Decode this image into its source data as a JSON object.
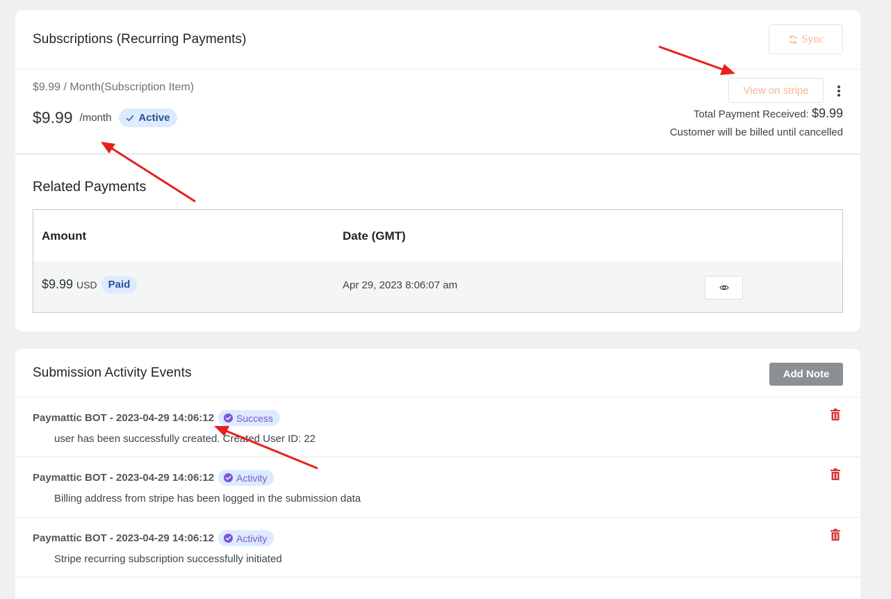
{
  "subscription_card": {
    "title": "Subscriptions (Recurring Payments)",
    "sync_label": "Sync",
    "plan_name": "$9.99 / Month(Subscription Item)",
    "price": "$9.99",
    "interval": "/month",
    "status": "Active",
    "view_on_stripe_label": "View on stripe",
    "total_label": "Total Payment Received:",
    "total_value": "$9.99",
    "billing_note": "Customer will be billed until cancelled"
  },
  "related_payments": {
    "title": "Related Payments",
    "columns": [
      "Amount",
      "Date (GMT)"
    ],
    "rows": [
      {
        "amount": "$9.99",
        "currency": "USD",
        "status": "Paid",
        "date": "Apr 29, 2023 8:06:07 am"
      }
    ]
  },
  "activity": {
    "title": "Submission Activity Events",
    "add_note_label": "Add Note",
    "events": [
      {
        "author": "Paymattic BOT - 2023-04-29 14:06:12",
        "badge": "Success",
        "text": "user has been successfully created. Created User ID: 22"
      },
      {
        "author": "Paymattic BOT - 2023-04-29 14:06:12",
        "badge": "Activity",
        "text": "Billing address from stripe has been logged in the submission data"
      },
      {
        "author": "Paymattic BOT - 2023-04-29 14:06:12",
        "badge": "Activity",
        "text": "Stripe recurring subscription successfully initiated"
      }
    ]
  },
  "icons": {
    "sync": "sync-icon",
    "check": "check-icon",
    "more": "more-vertical-icon",
    "eye": "eye-icon",
    "badge_check": "check-circle-icon",
    "trash": "trash-icon"
  },
  "colors": {
    "accent_orange": "#f6b78f",
    "badge_bg": "#dcebfd",
    "badge_text": "#2c4e96",
    "event_badge_text": "#7b55d8",
    "trash_red": "#d63638",
    "add_note_bg": "#8c8f94",
    "annotation_arrow": "#e8201c"
  }
}
